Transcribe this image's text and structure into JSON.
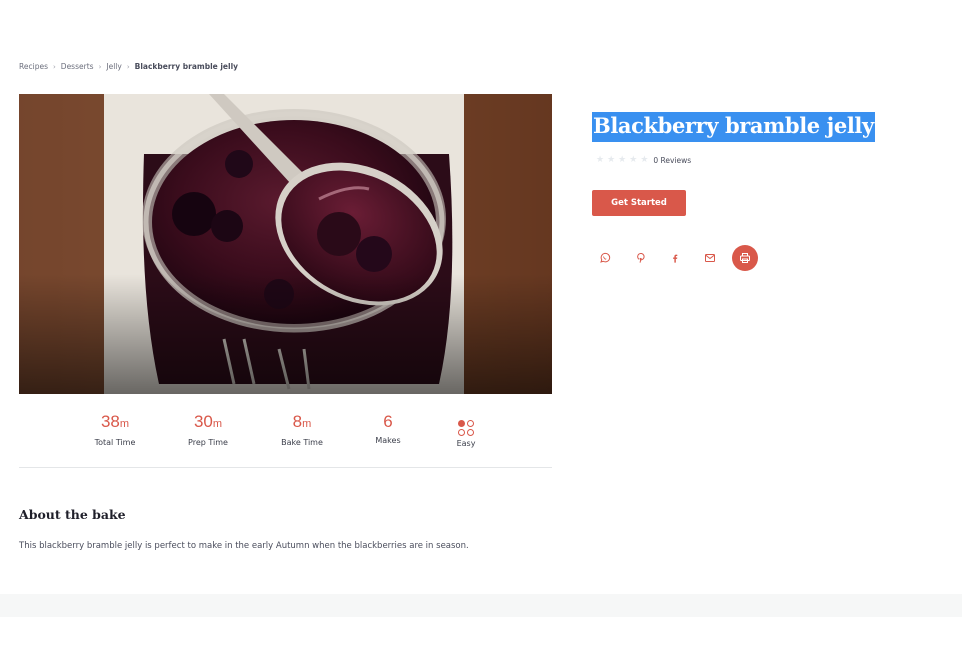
{
  "breadcrumb": [
    {
      "label": "Recipes"
    },
    {
      "label": "Desserts"
    },
    {
      "label": "Jelly"
    },
    {
      "label": "Blackberry bramble jelly"
    }
  ],
  "recipe": {
    "title": "Blackberry bramble jelly",
    "rating": {
      "stars": 5,
      "filled": 0,
      "reviews_label": "0 Reviews"
    },
    "cta_label": "Get Started"
  },
  "stats": {
    "total": {
      "value": "38",
      "unit": "m",
      "label": "Total Time"
    },
    "prep": {
      "value": "30",
      "unit": "m",
      "label": "Prep Time"
    },
    "bake": {
      "value": "8",
      "unit": "m",
      "label": "Bake Time"
    },
    "makes": {
      "value": "6",
      "label": "Makes"
    },
    "difficulty": {
      "label": "Easy",
      "icon": "difficulty-dots-icon"
    }
  },
  "share": [
    {
      "icon": "whatsapp-icon"
    },
    {
      "icon": "pinterest-icon"
    },
    {
      "icon": "facebook-icon"
    },
    {
      "icon": "email-icon"
    },
    {
      "icon": "print-icon"
    }
  ],
  "about": {
    "title": "About the bake",
    "text": "This blackberry bramble jelly is perfect to make in the early Autumn when the blackberries are in season."
  },
  "colors": {
    "accent": "#d9584a",
    "selection": "#3990f0",
    "star_empty": "#e6eaee"
  }
}
